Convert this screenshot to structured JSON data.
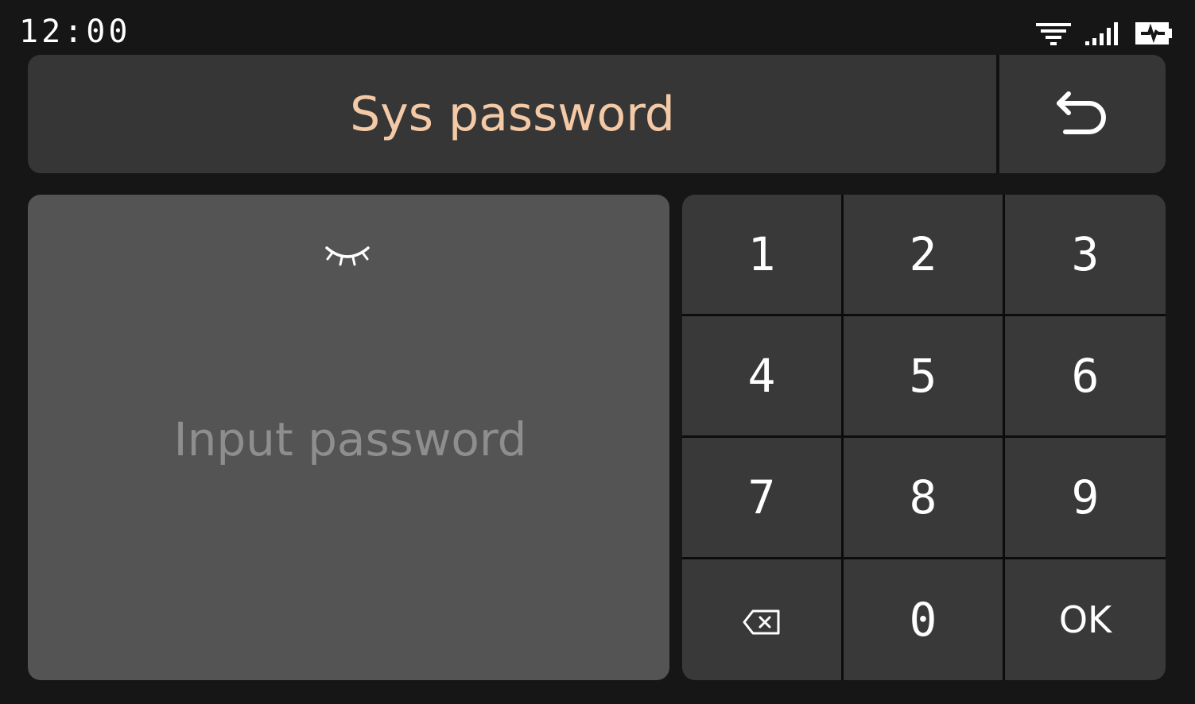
{
  "status_bar": {
    "time": "12:00",
    "icons": [
      "wifi-icon",
      "signal-icon",
      "battery-charging-icon"
    ]
  },
  "header": {
    "title": "Sys password",
    "back_icon": "back-arrow-icon"
  },
  "password": {
    "placeholder": "Input password",
    "value": "",
    "visibility_icon": "eye-closed-icon"
  },
  "keypad": {
    "keys": [
      "1",
      "2",
      "3",
      "4",
      "5",
      "6",
      "7",
      "8",
      "9",
      "",
      "0",
      "OK"
    ],
    "backspace_icon": "backspace-icon"
  },
  "colors": {
    "background": "#161616",
    "panel": "#363636",
    "input_panel": "#545454",
    "title_accent": "#f4c9a6",
    "key_text": "#ffffff",
    "placeholder_text": "#8e8e8e"
  }
}
